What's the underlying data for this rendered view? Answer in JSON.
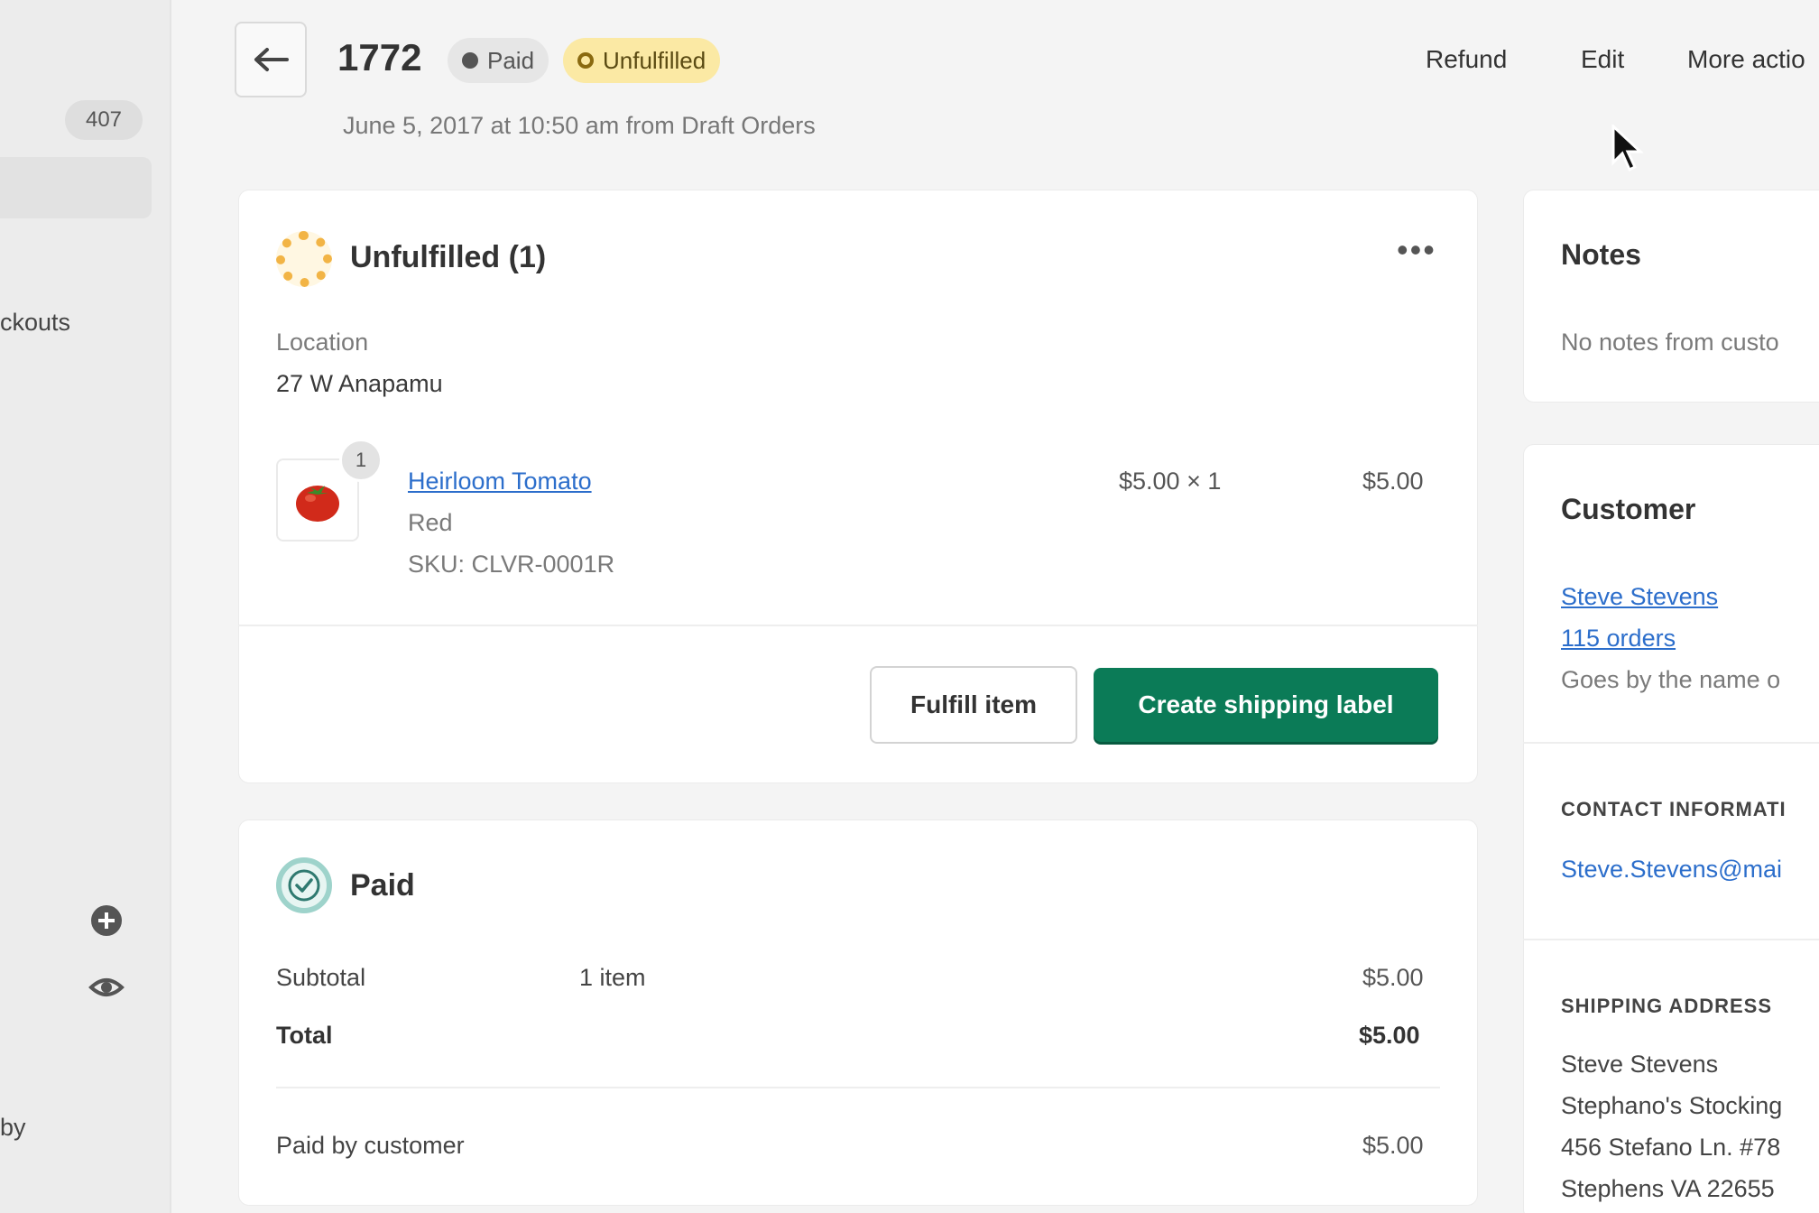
{
  "sidebar": {
    "count_badge": "407",
    "nav_text": "ckouts",
    "footer_text": "by",
    "icons": [
      "plus-circle-icon",
      "eye-icon"
    ]
  },
  "header": {
    "order_number": "1772",
    "paid_badge": "Paid",
    "unfulfilled_badge": "Unfulfilled",
    "subtitle": "June 5, 2017 at 10:50 am from Draft Orders",
    "actions": [
      "Refund",
      "Edit",
      "More actio"
    ]
  },
  "fulfillment_card": {
    "title": "Unfulfilled (1)",
    "menu": "•••",
    "location_label": "Location",
    "location_value": "27 W Anapamu",
    "item": {
      "quantity_badge": "1",
      "name": "Heirloom Tomato",
      "variant": "Red",
      "sku": "SKU: CLVR-0001R",
      "price_qty": "$5.00 × 1",
      "total": "$5.00"
    },
    "fulfill_button": "Fulfill item",
    "shipping_button": "Create shipping label"
  },
  "payment_card": {
    "title": "Paid",
    "subtotal_label": "Subtotal",
    "subtotal_items": "1 item",
    "subtotal_value": "$5.00",
    "total_label": "Total",
    "total_value": "$5.00",
    "paid_by_label": "Paid by customer",
    "paid_by_value": "$5.00"
  },
  "notes_card": {
    "title": "Notes",
    "text": "No notes from custo"
  },
  "customer_card": {
    "title": "Customer",
    "name": "Steve Stevens",
    "orders": "115 orders",
    "note": "Goes by the name o",
    "contact_label": "CONTACT INFORMATI",
    "email": "Steve.Stevens@mai",
    "shipping_label": "SHIPPING ADDRESS",
    "address": [
      "Steve Stevens",
      "Stephano's Stocking",
      "456 Stefano Ln. #78",
      "Stephens VA 22655"
    ]
  },
  "colors": {
    "primary_button": "#0b7b57",
    "unfulfilled_badge": "#fbe9a4",
    "link": "#2c6ecb"
  }
}
